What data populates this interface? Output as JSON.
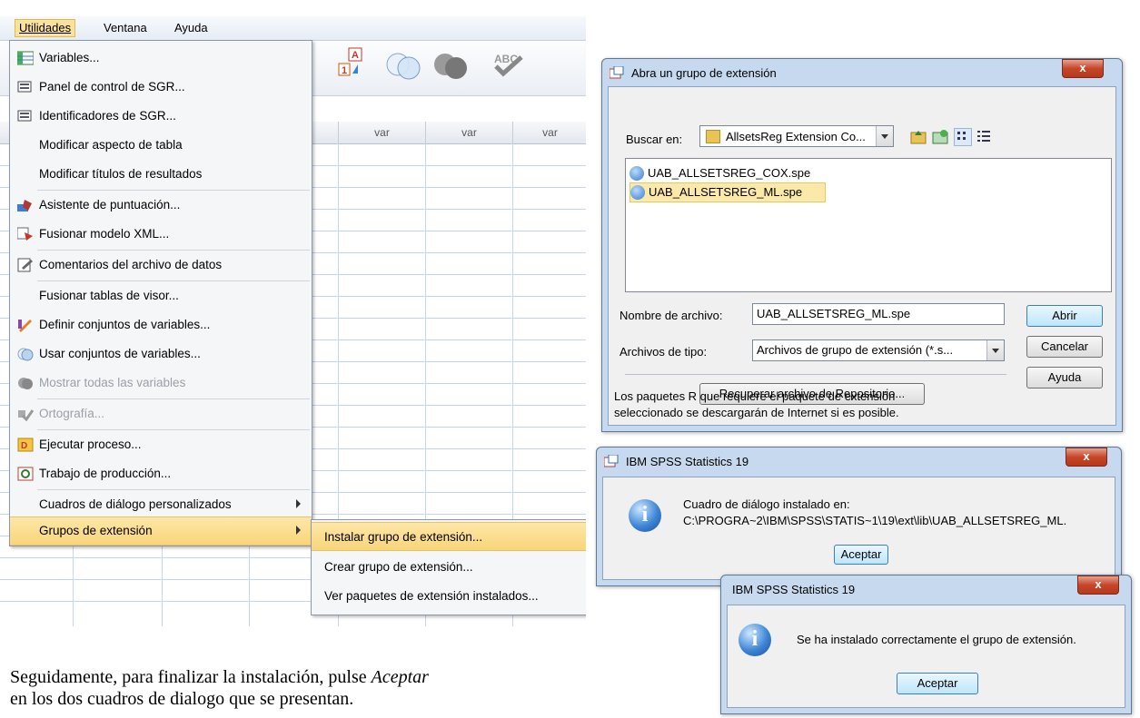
{
  "spss": {
    "menubar": {
      "utilidades": "Utilidades",
      "ventana": "Ventana",
      "ayuda": "Ayuda"
    },
    "columns": [
      "var",
      "var",
      "var"
    ],
    "menu": {
      "items": [
        {
          "label": "Variables...",
          "icon": "variables-icon",
          "disabled": false
        },
        {
          "label": "Panel de control de SGR...",
          "icon": "sgr-panel-icon",
          "disabled": false
        },
        {
          "label": "Identificadores de SGR...",
          "icon": "sgr-identifiers-icon",
          "disabled": false
        },
        {
          "label": "Modificar aspecto de tabla",
          "icon": "",
          "disabled": false
        },
        {
          "label": "Modificar títulos de resultados",
          "icon": "",
          "disabled": false
        },
        {
          "label": "Asistente de puntuación...",
          "icon": "scoring-wizard-icon",
          "disabled": false
        },
        {
          "label": "Fusionar modelo XML...",
          "icon": "merge-xml-icon",
          "disabled": false
        },
        {
          "label": "Comentarios del archivo de datos",
          "icon": "comments-icon",
          "disabled": false
        },
        {
          "label": "Fusionar tablas de visor...",
          "icon": "",
          "disabled": false
        },
        {
          "label": "Definir conjuntos de variables...",
          "icon": "define-sets-icon",
          "disabled": false
        },
        {
          "label": "Usar conjuntos de variables...",
          "icon": "use-sets-icon",
          "disabled": false
        },
        {
          "label": "Mostrar todas las variables",
          "icon": "show-all-icon",
          "disabled": true
        },
        {
          "label": "Ortografía...",
          "icon": "spelling-icon",
          "disabled": true
        },
        {
          "label": "Ejecutar proceso...",
          "icon": "run-script-icon",
          "disabled": false
        },
        {
          "label": "Trabajo de producción...",
          "icon": "production-job-icon",
          "disabled": false
        },
        {
          "label": "Cuadros de diálogo personalizados",
          "icon": "",
          "disabled": false
        },
        {
          "label": "Grupos de extensión",
          "icon": "",
          "disabled": false
        }
      ]
    },
    "submenu": {
      "items": [
        {
          "label": "Instalar grupo de extensión..."
        },
        {
          "label": "Crear grupo de extensión..."
        },
        {
          "label": "Ver paquetes de extensión instalados..."
        }
      ]
    }
  },
  "caption": {
    "line1_a": "Seguidamente, para finalizar la instalación, pulse ",
    "line1_em": "Aceptar",
    "line2": "en los dos cuadros de dialogo que se presentan."
  },
  "dialog_open": {
    "title": "Abra un grupo de extensión",
    "close": "x",
    "lookin_label": "Buscar en:",
    "lookin_value": "AllsetsReg Extension Co...",
    "files": [
      {
        "name": "UAB_ALLSETSREG_COX.spe",
        "selected": false
      },
      {
        "name": "UAB_ALLSETSREG_ML.spe",
        "selected": true
      }
    ],
    "filename_label": "Nombre de archivo:",
    "filename_value": "UAB_ALLSETSREG_ML.spe",
    "filetype_label": "Archivos de tipo:",
    "filetype_value": "Archivos de grupo de extensión (*.s...",
    "open_button": "Abrir",
    "cancel_button": "Cancelar",
    "help_button": "Ayuda",
    "repo_button": "Recuperar archivo de Repositorio...",
    "note_line1": "Los paquetes R que requiere el paquete de extensión",
    "note_line2": "seleccionado se descargarán de Internet si es posible."
  },
  "dialog_installed": {
    "title": "IBM SPSS Statistics 19",
    "close": "x",
    "message_line1": "Cuadro de diálogo instalado en:",
    "message_line2": "C:\\PROGRA~2\\IBM\\SPSS\\STATIS~1\\19\\ext\\lib\\UAB_ALLSETSREG_ML.",
    "ok_button": "Aceptar"
  },
  "dialog_success": {
    "title": "IBM SPSS Statistics 19",
    "close": "x",
    "message": "Se ha instalado correctamente el grupo de extensión.",
    "ok_button": "Aceptar"
  },
  "colors": {
    "menu_highlight": "#f9d57a",
    "dialog_frame": "#c7d9ef",
    "close_button": "#c6462a"
  }
}
